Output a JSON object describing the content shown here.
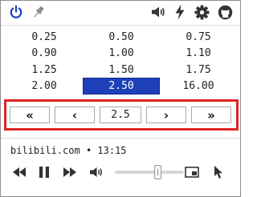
{
  "toolbar": {
    "icons": [
      "power-icon",
      "pin-icon",
      "volume-icon",
      "lightning-icon",
      "gear-icon",
      "github-icon"
    ],
    "accent_color": "#1d3fb8"
  },
  "speeds": {
    "rows": [
      [
        "0.25",
        "0.50",
        "0.75"
      ],
      [
        "0.90",
        "1.00",
        "1.10"
      ],
      [
        "1.25",
        "1.50",
        "1.75"
      ],
      [
        "2.00",
        "2.50",
        "16.00"
      ]
    ],
    "selected": "2.50"
  },
  "nav": {
    "first": "«",
    "prev": "‹",
    "value": "2.5",
    "next": "›",
    "last": "»",
    "highlight_color": "#e02424"
  },
  "media": {
    "site": "bilibili.com",
    "separator": "•",
    "time": "13:15",
    "volume_level": 0.62
  }
}
